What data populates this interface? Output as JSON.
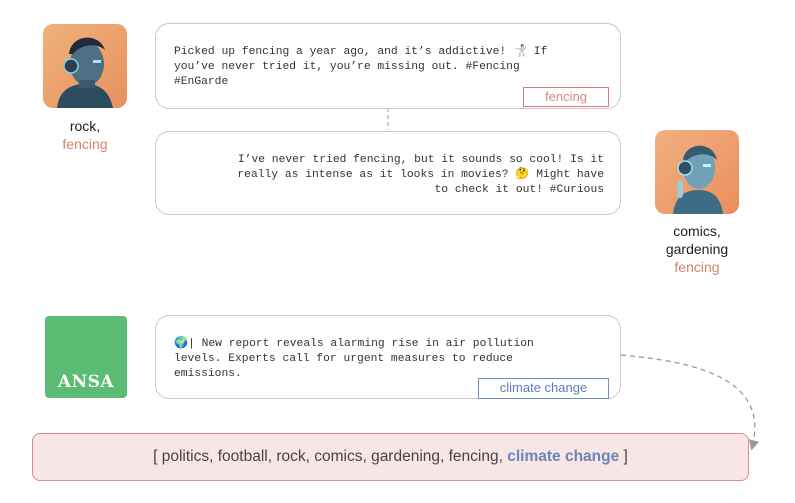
{
  "user1": {
    "avatar_icon": "robot-man-portrait-icon",
    "interests": "rock,",
    "tag": "fencing",
    "post": "Picked up fencing a year ago, and it’s addictive! 🤺 If you’ve never tried it, you’re missing out. #Fencing #EnGarde",
    "post_line1": "Picked up fencing a year ago, and it’s addictive! 🤺 If",
    "post_line2": "you’ve never tried it, you’re missing out. #Fencing",
    "post_line3": "#EnGarde",
    "topic_chip": "fencing"
  },
  "user2": {
    "avatar_icon": "robot-woman-portrait-icon",
    "interests_line1": "comics,",
    "interests_line2": "gardening",
    "tag": "fencing",
    "post_line1": "I’ve never tried fencing, but it sounds so cool! Is it",
    "post_line2": "really as intense as it looks in movies? 🤔 Might have",
    "post_line3": "to check it out! #Curious"
  },
  "news": {
    "logo_text": "ANSA",
    "post_line1": "🌍| New report reveals alarming rise in air pollution",
    "post_line2": "levels. Experts call for urgent measures to reduce",
    "post_line3": "emissions.",
    "topic_chip": "climate change"
  },
  "interest_list": {
    "open": "[ ",
    "items": "politics, football, rock, comics, gardening, fencing, ",
    "new_item": "climate change",
    "close": " ]"
  },
  "colors": {
    "tag_orange": "#d4846a",
    "chip_red": "#e07a7a",
    "chip_blue": "#6d8fc4",
    "ansa_green": "#5bbd74",
    "list_bg": "#f8e6e6"
  }
}
